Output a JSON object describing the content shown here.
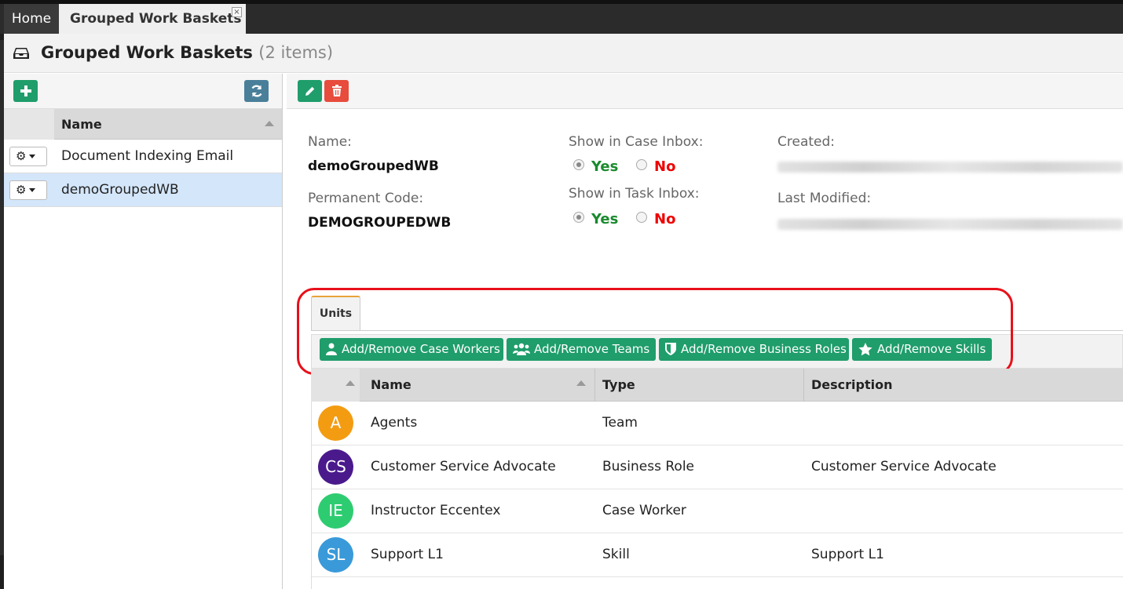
{
  "tabs": {
    "home": "Home",
    "active": "Grouped Work Baskets",
    "close": "×"
  },
  "header": {
    "title": "Grouped Work Baskets",
    "count": "(2 items)"
  },
  "left": {
    "add_icon": "plus-icon",
    "refresh_icon": "refresh-icon",
    "column_header": "Name",
    "items": [
      {
        "label": "Document Indexing Email",
        "selected": false
      },
      {
        "label": "demoGroupedWB",
        "selected": true
      }
    ]
  },
  "details": {
    "name_label": "Name:",
    "name_value": "demoGroupedWB",
    "code_label": "Permanent Code:",
    "code_value": "DEMOGROUPEDWB",
    "case_inbox_label": "Show in Case Inbox:",
    "task_inbox_label": "Show in Task Inbox:",
    "yes": "Yes",
    "no": "No",
    "created_label": "Created:",
    "modified_label": "Last Modified:"
  },
  "units": {
    "tab_label": "Units",
    "actions": [
      "Add/Remove Case Workers",
      "Add/Remove Teams",
      "Add/Remove Business Roles",
      "Add/Remove Skills"
    ],
    "columns": [
      "Name",
      "Type",
      "Description"
    ],
    "rows": [
      {
        "initials": "A",
        "name": "Agents",
        "type": "Team",
        "description": "",
        "color": "#f39c12"
      },
      {
        "initials": "CS",
        "name": "Customer Service Advocate",
        "type": "Business Role",
        "description": "Customer Service Advocate",
        "color": "#4a1a8c"
      },
      {
        "initials": "IE",
        "name": "Instructor Eccentex",
        "type": "Case Worker",
        "description": "",
        "color": "#2ecc71"
      },
      {
        "initials": "SL",
        "name": "Support L1",
        "type": "Skill",
        "description": "Support L1",
        "color": "#3a9ad9"
      }
    ]
  },
  "colors": {
    "green": "#1f9d6b",
    "red": "#e74c3c",
    "highlight": "#e8101a"
  }
}
